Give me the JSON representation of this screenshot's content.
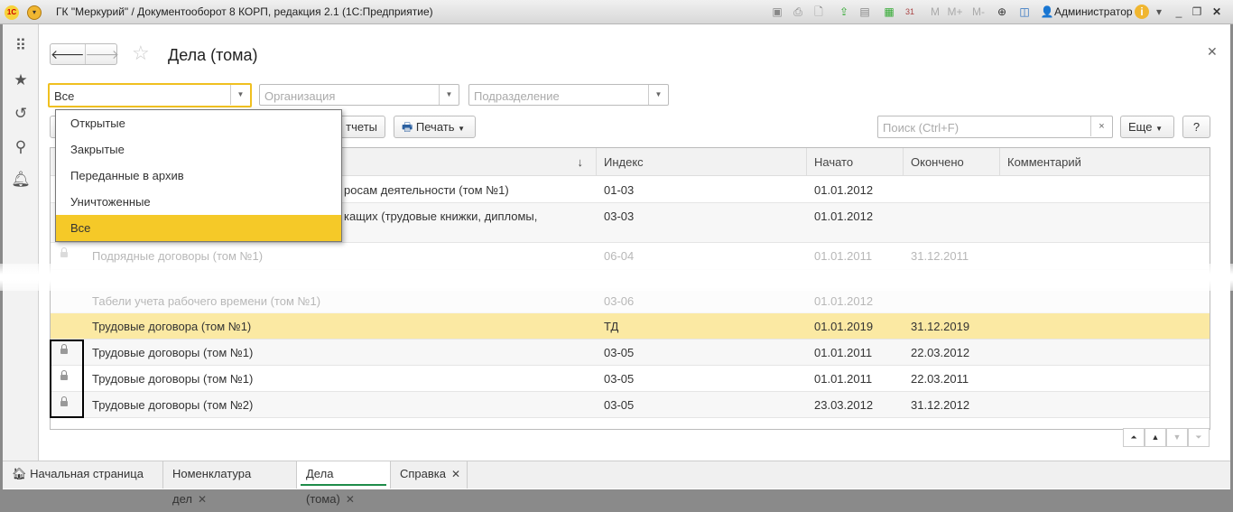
{
  "window": {
    "title": "ГК \"Меркурий\" / Документооборот 8 КОРП, редакция 2.1  (1С:Предприятие)",
    "user": "Администратор",
    "mem": [
      "M",
      "M+",
      "M-"
    ]
  },
  "page": {
    "title": "Дела (тома)"
  },
  "filters": {
    "status_value": "Все",
    "org_placeholder": "Организация",
    "dept_placeholder": "Подразделение"
  },
  "toolbar": {
    "reports_label": "тчеты",
    "print_label": "Печать",
    "search_placeholder": "Поиск (Ctrl+F)",
    "more_label": "Еще",
    "help_label": "?"
  },
  "status_options": [
    {
      "label": "Открытые"
    },
    {
      "label": "Закрытые"
    },
    {
      "label": "Переданные в архив"
    },
    {
      "label": "Уничтоженные"
    },
    {
      "label": "Все",
      "selected": true
    }
  ],
  "table": {
    "columns": [
      "Индекс",
      "Начато",
      "Окончено",
      "Комментарий"
    ],
    "sort_indicator": "↓",
    "rows": [
      {
        "name": "росам деятельности (том №1)",
        "index": "01-03",
        "start": "01.01.2012",
        "end": "",
        "locked": false
      },
      {
        "name": "кащих (трудовые книжки, дипломы,",
        "index": "03-03",
        "start": "01.01.2012",
        "end": "",
        "locked": false
      },
      {
        "name": "Подрядные договоры (том №1)",
        "index": "06-04",
        "start": "01.01.2011",
        "end": "31.12.2011",
        "locked": true
      },
      {
        "name": "Табели учета рабочего времени (том №1)",
        "index": "03-06",
        "start": "01.01.2012",
        "end": "",
        "locked": false
      },
      {
        "name": "Трудовые договора (том №1)",
        "index": "ТД",
        "start": "01.01.2019",
        "end": "31.12.2019",
        "locked": false
      },
      {
        "name": "Трудовые договоры (том №1)",
        "index": "03-05",
        "start": "01.01.2011",
        "end": "22.03.2012",
        "locked": true
      },
      {
        "name": "Трудовые договоры (том №1)",
        "index": "03-05",
        "start": "01.01.2011",
        "end": "22.03.2011",
        "locked": true
      },
      {
        "name": "Трудовые договоры (том №2)",
        "index": "03-05",
        "start": "23.03.2012",
        "end": "31.12.2012",
        "locked": true
      }
    ]
  },
  "tabs": [
    {
      "label": "Начальная страница"
    },
    {
      "label": "Номенклатура дел"
    },
    {
      "label": "Дела (тома)",
      "active": true
    },
    {
      "label": "Справка"
    }
  ],
  "colors": {
    "accent": "#f5c928",
    "selected_row": "#fbe9a3",
    "active_tab": "#1e8c4a"
  }
}
